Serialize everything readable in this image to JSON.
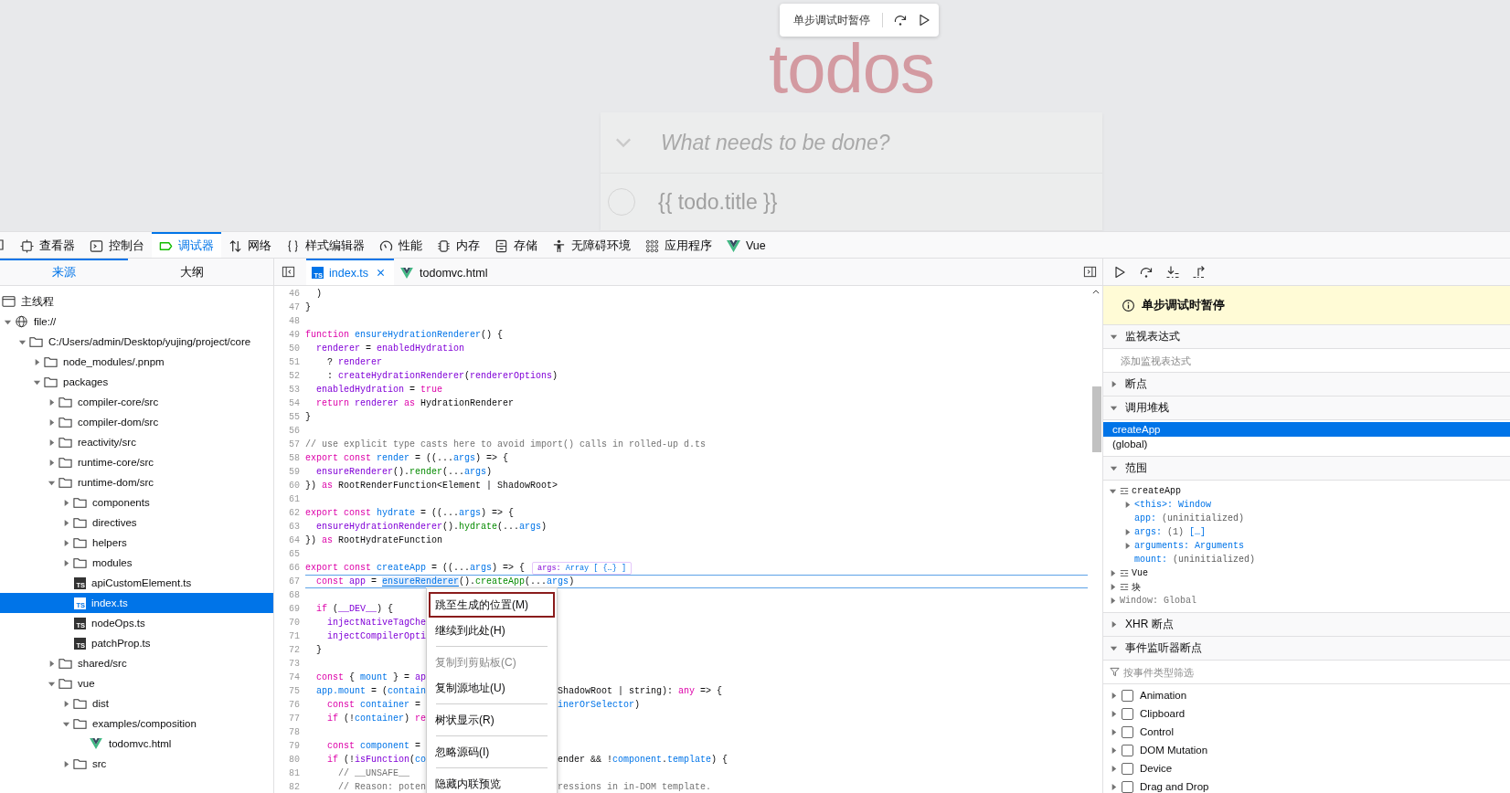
{
  "page": {
    "title": "todos",
    "pause_popup": {
      "message": "单步调试时暂停"
    },
    "new_todo": {
      "placeholder": "What needs to be done?"
    },
    "todos": [
      {
        "title": "{{ todo.title }}",
        "completed": false
      }
    ]
  },
  "toolbar": {
    "tabs": [
      {
        "label": "查看器",
        "selected": false
      },
      {
        "label": "控制台",
        "selected": false
      },
      {
        "label": "调试器",
        "selected": true
      },
      {
        "label": "网络",
        "selected": false
      },
      {
        "label": "样式编辑器",
        "selected": false
      },
      {
        "label": "性能",
        "selected": false
      },
      {
        "label": "内存",
        "selected": false
      },
      {
        "label": "存储",
        "selected": false
      },
      {
        "label": "无障碍环境",
        "selected": false
      },
      {
        "label": "应用程序",
        "selected": false
      },
      {
        "label": "Vue",
        "selected": false
      }
    ]
  },
  "sources": {
    "tabs": [
      {
        "label": "来源",
        "selected": true
      },
      {
        "label": "大纲",
        "selected": false
      }
    ],
    "tree": [
      {
        "label": "主线程",
        "kind": "thread",
        "selected": false
      },
      {
        "label": "file://",
        "kind": "domain",
        "expanded": true,
        "selected": false,
        "children": [
          {
            "label": "C:/Users/admin/Desktop/yujing/project/core",
            "kind": "folder",
            "expanded": true,
            "selected": false,
            "children": [
              {
                "label": "node_modules/.pnpm",
                "kind": "folder",
                "expanded": false,
                "selected": false
              },
              {
                "label": "packages",
                "kind": "folder",
                "expanded": true,
                "selected": false,
                "children": [
                  {
                    "label": "compiler-core/src",
                    "kind": "folder",
                    "expanded": false,
                    "selected": false
                  },
                  {
                    "label": "compiler-dom/src",
                    "kind": "folder",
                    "expanded": false,
                    "selected": false
                  },
                  {
                    "label": "reactivity/src",
                    "kind": "folder",
                    "expanded": false,
                    "selected": false
                  },
                  {
                    "label": "runtime-core/src",
                    "kind": "folder",
                    "expanded": false,
                    "selected": false
                  },
                  {
                    "label": "runtime-dom/src",
                    "kind": "folder",
                    "expanded": true,
                    "selected": false,
                    "children": [
                      {
                        "label": "components",
                        "kind": "folder",
                        "expanded": false,
                        "selected": false
                      },
                      {
                        "label": "directives",
                        "kind": "folder",
                        "expanded": false,
                        "selected": false
                      },
                      {
                        "label": "helpers",
                        "kind": "folder",
                        "expanded": false,
                        "selected": false
                      },
                      {
                        "label": "modules",
                        "kind": "folder",
                        "expanded": false,
                        "selected": false
                      },
                      {
                        "label": "apiCustomElement.ts",
                        "kind": "ts-file",
                        "badge": "TS",
                        "selected": false
                      },
                      {
                        "label": "index.ts",
                        "kind": "ts-file",
                        "badge": "TS",
                        "selected": true
                      },
                      {
                        "label": "nodeOps.ts",
                        "kind": "ts-file",
                        "badge": "TS",
                        "selected": false
                      },
                      {
                        "label": "patchProp.ts",
                        "kind": "ts-file",
                        "badge": "TS",
                        "selected": false
                      }
                    ]
                  },
                  {
                    "label": "shared/src",
                    "kind": "folder",
                    "expanded": false,
                    "selected": false
                  },
                  {
                    "label": "vue",
                    "kind": "folder",
                    "expanded": true,
                    "selected": false,
                    "children": [
                      {
                        "label": "dist",
                        "kind": "folder",
                        "expanded": false,
                        "selected": false
                      },
                      {
                        "label": "examples/composition",
                        "kind": "folder",
                        "expanded": true,
                        "selected": false,
                        "children": [
                          {
                            "label": "todomvc.html",
                            "kind": "vue-file",
                            "selected": false
                          }
                        ]
                      },
                      {
                        "label": "src",
                        "kind": "folder",
                        "expanded": false,
                        "selected": false
                      }
                    ]
                  }
                ]
              }
            ]
          }
        ]
      }
    ]
  },
  "editor": {
    "tabs": [
      {
        "label": "index.ts",
        "kind": "ts-file",
        "badge": "TS",
        "selected": true,
        "closable": true
      },
      {
        "label": "todomvc.html",
        "kind": "vue-file",
        "selected": false,
        "closable": false
      }
    ],
    "lines": [
      {
        "num": "46",
        "paused": false,
        "tokens": [
          {
            "text": "  )",
            "kind": "plain"
          }
        ]
      },
      {
        "num": "47",
        "paused": false,
        "tokens": [
          {
            "text": "}",
            "kind": "plain"
          }
        ]
      },
      {
        "num": "48",
        "paused": false
      },
      {
        "num": "49",
        "paused": false,
        "tokens": [
          {
            "text": "function ",
            "kind": "keyword"
          },
          {
            "text": "ensureHydrationRenderer",
            "kind": "def"
          },
          {
            "text": "() {",
            "kind": "plain"
          }
        ]
      },
      {
        "num": "50",
        "paused": false,
        "tokens": [
          {
            "text": "  renderer",
            "kind": "var"
          },
          {
            "text": " = ",
            "kind": "plain"
          },
          {
            "text": "enabledHydration",
            "kind": "var"
          }
        ]
      },
      {
        "num": "51",
        "paused": false,
        "tokens": [
          {
            "text": "    ? ",
            "kind": "plain"
          },
          {
            "text": "renderer",
            "kind": "var"
          }
        ]
      },
      {
        "num": "52",
        "paused": false,
        "tokens": [
          {
            "text": "    : ",
            "kind": "plain"
          },
          {
            "text": "createHydrationRenderer",
            "kind": "var"
          },
          {
            "text": "(",
            "kind": "plain"
          },
          {
            "text": "rendererOptions",
            "kind": "var"
          },
          {
            "text": ")",
            "kind": "plain"
          }
        ]
      },
      {
        "num": "53",
        "paused": false,
        "tokens": [
          {
            "text": "  enabledHydration",
            "kind": "var"
          },
          {
            "text": " = ",
            "kind": "plain"
          },
          {
            "text": "true",
            "kind": "keyword"
          }
        ]
      },
      {
        "num": "54",
        "paused": false,
        "tokens": [
          {
            "text": "  return ",
            "kind": "keyword"
          },
          {
            "text": "renderer ",
            "kind": "var"
          },
          {
            "text": "as",
            "kind": "keyword"
          },
          {
            "text": " HydrationRenderer",
            "kind": "plain"
          }
        ]
      },
      {
        "num": "55",
        "paused": false,
        "tokens": [
          {
            "text": "}",
            "kind": "plain"
          }
        ]
      },
      {
        "num": "56",
        "paused": false
      },
      {
        "num": "57",
        "paused": false,
        "tokens": [
          {
            "text": "// use explicit type casts here to avoid import() calls in rolled-up d.ts",
            "kind": "comment"
          }
        ]
      },
      {
        "num": "58",
        "paused": false,
        "tokens": [
          {
            "text": "export const ",
            "kind": "keyword"
          },
          {
            "text": "render",
            "kind": "def"
          },
          {
            "text": " = ((...",
            "kind": "plain"
          },
          {
            "text": "args",
            "kind": "def"
          },
          {
            "text": ") => {",
            "kind": "plain"
          }
        ]
      },
      {
        "num": "59",
        "paused": false,
        "tokens": [
          {
            "text": "  ensureRenderer",
            "kind": "var"
          },
          {
            "text": "().",
            "kind": "plain"
          },
          {
            "text": "render",
            "kind": "method"
          },
          {
            "text": "(...",
            "kind": "plain"
          },
          {
            "text": "args",
            "kind": "def"
          },
          {
            "text": ")",
            "kind": "plain"
          }
        ]
      },
      {
        "num": "60",
        "paused": false,
        "tokens": [
          {
            "text": "}) ",
            "kind": "plain"
          },
          {
            "text": "as",
            "kind": "keyword"
          },
          {
            "text": " RootRenderFunction<Element | ShadowRoot>",
            "kind": "plain"
          }
        ]
      },
      {
        "num": "61",
        "paused": false
      },
      {
        "num": "62",
        "paused": false,
        "tokens": [
          {
            "text": "export const ",
            "kind": "keyword"
          },
          {
            "text": "hydrate",
            "kind": "def"
          },
          {
            "text": " = ((...",
            "kind": "plain"
          },
          {
            "text": "args",
            "kind": "def"
          },
          {
            "text": ") => {",
            "kind": "plain"
          }
        ]
      },
      {
        "num": "63",
        "paused": false,
        "tokens": [
          {
            "text": "  ensureHydrationRenderer",
            "kind": "var"
          },
          {
            "text": "().",
            "kind": "plain"
          },
          {
            "text": "hydrate",
            "kind": "method"
          },
          {
            "text": "(...",
            "kind": "plain"
          },
          {
            "text": "args",
            "kind": "def"
          },
          {
            "text": ")",
            "kind": "plain"
          }
        ]
      },
      {
        "num": "64",
        "paused": false,
        "tokens": [
          {
            "text": "}) ",
            "kind": "plain"
          },
          {
            "text": "as",
            "kind": "keyword"
          },
          {
            "text": " RootHydrateFunction",
            "kind": "plain"
          }
        ]
      },
      {
        "num": "65",
        "paused": false
      },
      {
        "num": "66",
        "paused": false,
        "tokens": [
          {
            "text": "export const ",
            "kind": "keyword"
          },
          {
            "text": "createApp",
            "kind": "def"
          },
          {
            "text": " = ((...",
            "kind": "plain"
          },
          {
            "text": "args",
            "kind": "def"
          },
          {
            "text": ") => {",
            "kind": "plain"
          }
        ],
        "inline_preview": {
          "name": "args:",
          "value": "Array [ {…} ]"
        }
      },
      {
        "num": "67",
        "paused": true,
        "tokens": [
          {
            "text": "  const ",
            "kind": "keyword"
          },
          {
            "text": "app",
            "kind": "var"
          },
          {
            "text": " = ",
            "kind": "plain"
          },
          {
            "text": "ensureRenderer",
            "kind": "hovered"
          },
          {
            "text": "().",
            "kind": "plain"
          },
          {
            "text": "createApp",
            "kind": "method"
          },
          {
            "text": "(...",
            "kind": "plain"
          },
          {
            "text": "args",
            "kind": "def"
          },
          {
            "text": ")",
            "kind": "plain"
          }
        ]
      },
      {
        "num": "68",
        "paused": false
      },
      {
        "num": "69",
        "paused": false,
        "tokens": [
          {
            "text": "  if",
            "kind": "keyword"
          },
          {
            "text": " (",
            "kind": "plain"
          },
          {
            "text": "__DEV__",
            "kind": "var"
          },
          {
            "text": ") {",
            "kind": "plain"
          }
        ]
      },
      {
        "num": "70",
        "paused": false,
        "tokens": [
          {
            "text": "    injectNativeTagChe",
            "kind": "var"
          }
        ]
      },
      {
        "num": "71",
        "paused": false,
        "tokens": [
          {
            "text": "    injectCompilerOpti",
            "kind": "var"
          }
        ]
      },
      {
        "num": "72",
        "paused": false,
        "tokens": [
          {
            "text": "  }",
            "kind": "plain"
          }
        ]
      },
      {
        "num": "73",
        "paused": false
      },
      {
        "num": "74",
        "paused": false,
        "tokens": [
          {
            "text": "  const",
            "kind": "keyword"
          },
          {
            "text": " { ",
            "kind": "plain"
          },
          {
            "text": "mount",
            "kind": "def"
          },
          {
            "text": " } = ",
            "kind": "plain"
          },
          {
            "text": "ap",
            "kind": "var"
          }
        ]
      },
      {
        "num": "75",
        "paused": false,
        "tokens": [
          {
            "text": "  app.mount",
            "kind": "def"
          },
          {
            "text": " = (",
            "kind": "plain"
          },
          {
            "text": "contain",
            "kind": "def"
          }
        ],
        "after_menu": [
          {
            "text": "ShadowRoot | string): ",
            "kind": "plain"
          },
          {
            "text": "any",
            "kind": "keyword"
          },
          {
            "text": " => {",
            "kind": "plain"
          }
        ]
      },
      {
        "num": "76",
        "paused": false,
        "tokens": [
          {
            "text": "    const ",
            "kind": "keyword"
          },
          {
            "text": "container",
            "kind": "def"
          },
          {
            "text": " = ",
            "kind": "plain"
          }
        ],
        "after_menu": [
          {
            "text": "inerOrSelector",
            "kind": "def"
          },
          {
            "text": ")",
            "kind": "plain"
          }
        ]
      },
      {
        "num": "77",
        "paused": false,
        "tokens": [
          {
            "text": "    if",
            "kind": "keyword"
          },
          {
            "text": " (!",
            "kind": "plain"
          },
          {
            "text": "container",
            "kind": "def"
          },
          {
            "text": ") ",
            "kind": "plain"
          },
          {
            "text": "re",
            "kind": "keyword"
          }
        ]
      },
      {
        "num": "78",
        "paused": false
      },
      {
        "num": "79",
        "paused": false,
        "tokens": [
          {
            "text": "    const ",
            "kind": "keyword"
          },
          {
            "text": "component",
            "kind": "def"
          },
          {
            "text": " = ",
            "kind": "plain"
          }
        ]
      },
      {
        "num": "80",
        "paused": false,
        "tokens": [
          {
            "text": "    if",
            "kind": "keyword"
          },
          {
            "text": " (!",
            "kind": "plain"
          },
          {
            "text": "isFunction",
            "kind": "var"
          },
          {
            "text": "(",
            "kind": "plain"
          },
          {
            "text": "co",
            "kind": "def"
          }
        ],
        "after_menu": [
          {
            "text": "ender && !",
            "kind": "plain"
          },
          {
            "text": "component",
            "kind": "def"
          },
          {
            "text": ".",
            "kind": "plain"
          },
          {
            "text": "template",
            "kind": "def"
          },
          {
            "text": ") {",
            "kind": "plain"
          }
        ]
      },
      {
        "num": "81",
        "paused": false,
        "tokens": [
          {
            "text": "      // __UNSAFE__",
            "kind": "comment"
          }
        ]
      },
      {
        "num": "82",
        "paused": false,
        "tokens": [
          {
            "text": "      // Reason: poten",
            "kind": "comment"
          }
        ],
        "after_menu": [
          {
            "text": "ressions in in-DOM template.",
            "kind": "comment"
          }
        ]
      }
    ],
    "context_menu": [
      {
        "kind": "item",
        "label": "跳至生成的位置(M)",
        "focused": true,
        "disabled": false
      },
      {
        "kind": "item",
        "label": "继续到此处(H)",
        "focused": false,
        "disabled": false
      },
      {
        "kind": "separator"
      },
      {
        "kind": "item",
        "label": "复制到剪贴板(C)",
        "focused": false,
        "disabled": true
      },
      {
        "kind": "item",
        "label": "复制源地址(U)",
        "focused": false,
        "disabled": false
      },
      {
        "kind": "separator"
      },
      {
        "kind": "item",
        "label": "树状显示(R)",
        "focused": false,
        "disabled": false
      },
      {
        "kind": "separator"
      },
      {
        "kind": "item",
        "label": "忽略源码(I)",
        "focused": false,
        "disabled": false
      },
      {
        "kind": "separator"
      },
      {
        "kind": "item",
        "label": "隐藏内联预览",
        "focused": false,
        "disabled": false
      }
    ]
  },
  "debugger_sidebar": {
    "pause_banner": "单步调试时暂停",
    "sections": [
      {
        "kind": "watch",
        "title": "监视表达式",
        "expanded": true,
        "placeholder": "添加监视表达式"
      },
      {
        "title": "断点",
        "expanded": false
      },
      {
        "kind": "callstack",
        "title": "调用堆栈",
        "expanded": true,
        "frames": [
          {
            "name": "createApp",
            "selected": true
          },
          {
            "name": "(global)",
            "selected": false
          }
        ]
      },
      {
        "kind": "scopes",
        "title": "范围",
        "expanded": true,
        "scopes": [
          {
            "kind": "block",
            "name": "createApp",
            "expanded": true,
            "children": [
              {
                "kind": "object-variable",
                "name": "<this>:",
                "value": "Window",
                "expanded": false
              },
              {
                "kind": "plain-variable",
                "name": "app:",
                "value": "(uninitialized)"
              },
              {
                "kind": "object-variable",
                "name": "args:",
                "length": "(1)",
                "value": "[…]",
                "expanded": false
              },
              {
                "kind": "object-variable",
                "name": "arguments:",
                "value": "Arguments",
                "expanded": false
              },
              {
                "kind": "plain-variable",
                "name": "mount:",
                "value": "(uninitialized)"
              }
            ]
          },
          {
            "kind": "block",
            "name": "Vue",
            "expanded": false
          },
          {
            "kind": "block",
            "name": "块",
            "expanded": false
          },
          {
            "kind": "global",
            "name": "Window: Global",
            "expanded": false
          }
        ]
      },
      {
        "title": "XHR 断点",
        "expanded": false
      },
      {
        "kind": "events",
        "title": "事件监听器断点",
        "expanded": true,
        "placeholder": "按事件类型筛选",
        "categories": [
          {
            "label": "Animation",
            "checked": false,
            "expanded": false
          },
          {
            "label": "Clipboard",
            "checked": false,
            "expanded": false
          },
          {
            "label": "Control",
            "checked": false,
            "expanded": false
          },
          {
            "label": "DOM Mutation",
            "checked": false,
            "expanded": false
          },
          {
            "label": "Device",
            "checked": false,
            "expanded": false
          },
          {
            "label": "Drag and Drop",
            "checked": false,
            "expanded": false
          }
        ]
      }
    ]
  }
}
